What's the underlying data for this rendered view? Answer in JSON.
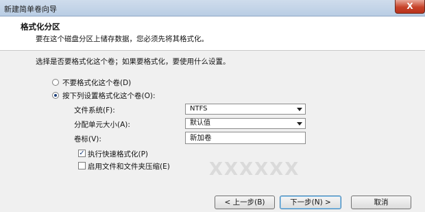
{
  "window": {
    "title": "新建简单卷向导",
    "close_glyph": "X"
  },
  "header": {
    "title": "格式化分区",
    "subtitle": "要在这个磁盘分区上储存数据，您必须先将其格式化。"
  },
  "main": {
    "question": "选择是否要格式化这个卷；如果要格式化，要使用什么设置。",
    "option_no_format": "不要格式化这个卷(D)",
    "option_format": "按下列设置格式化这个卷(O):",
    "filesystem_label": "文件系统(F):",
    "filesystem_value": "NTFS",
    "alloc_label": "分配单元大小(A):",
    "alloc_value": "默认值",
    "volume_label_label": "卷标(V):",
    "volume_label_value": "新加卷",
    "quick_format_label": "执行快速格式化(P)",
    "quick_format_checked": true,
    "compression_label": "启用文件和文件夹压缩(E)",
    "compression_checked": false
  },
  "footer": {
    "back_label": "< 上一步(B)",
    "next_label": "下一步(N) >",
    "cancel_label": "取消"
  },
  "watermark": "XXXXXX"
}
